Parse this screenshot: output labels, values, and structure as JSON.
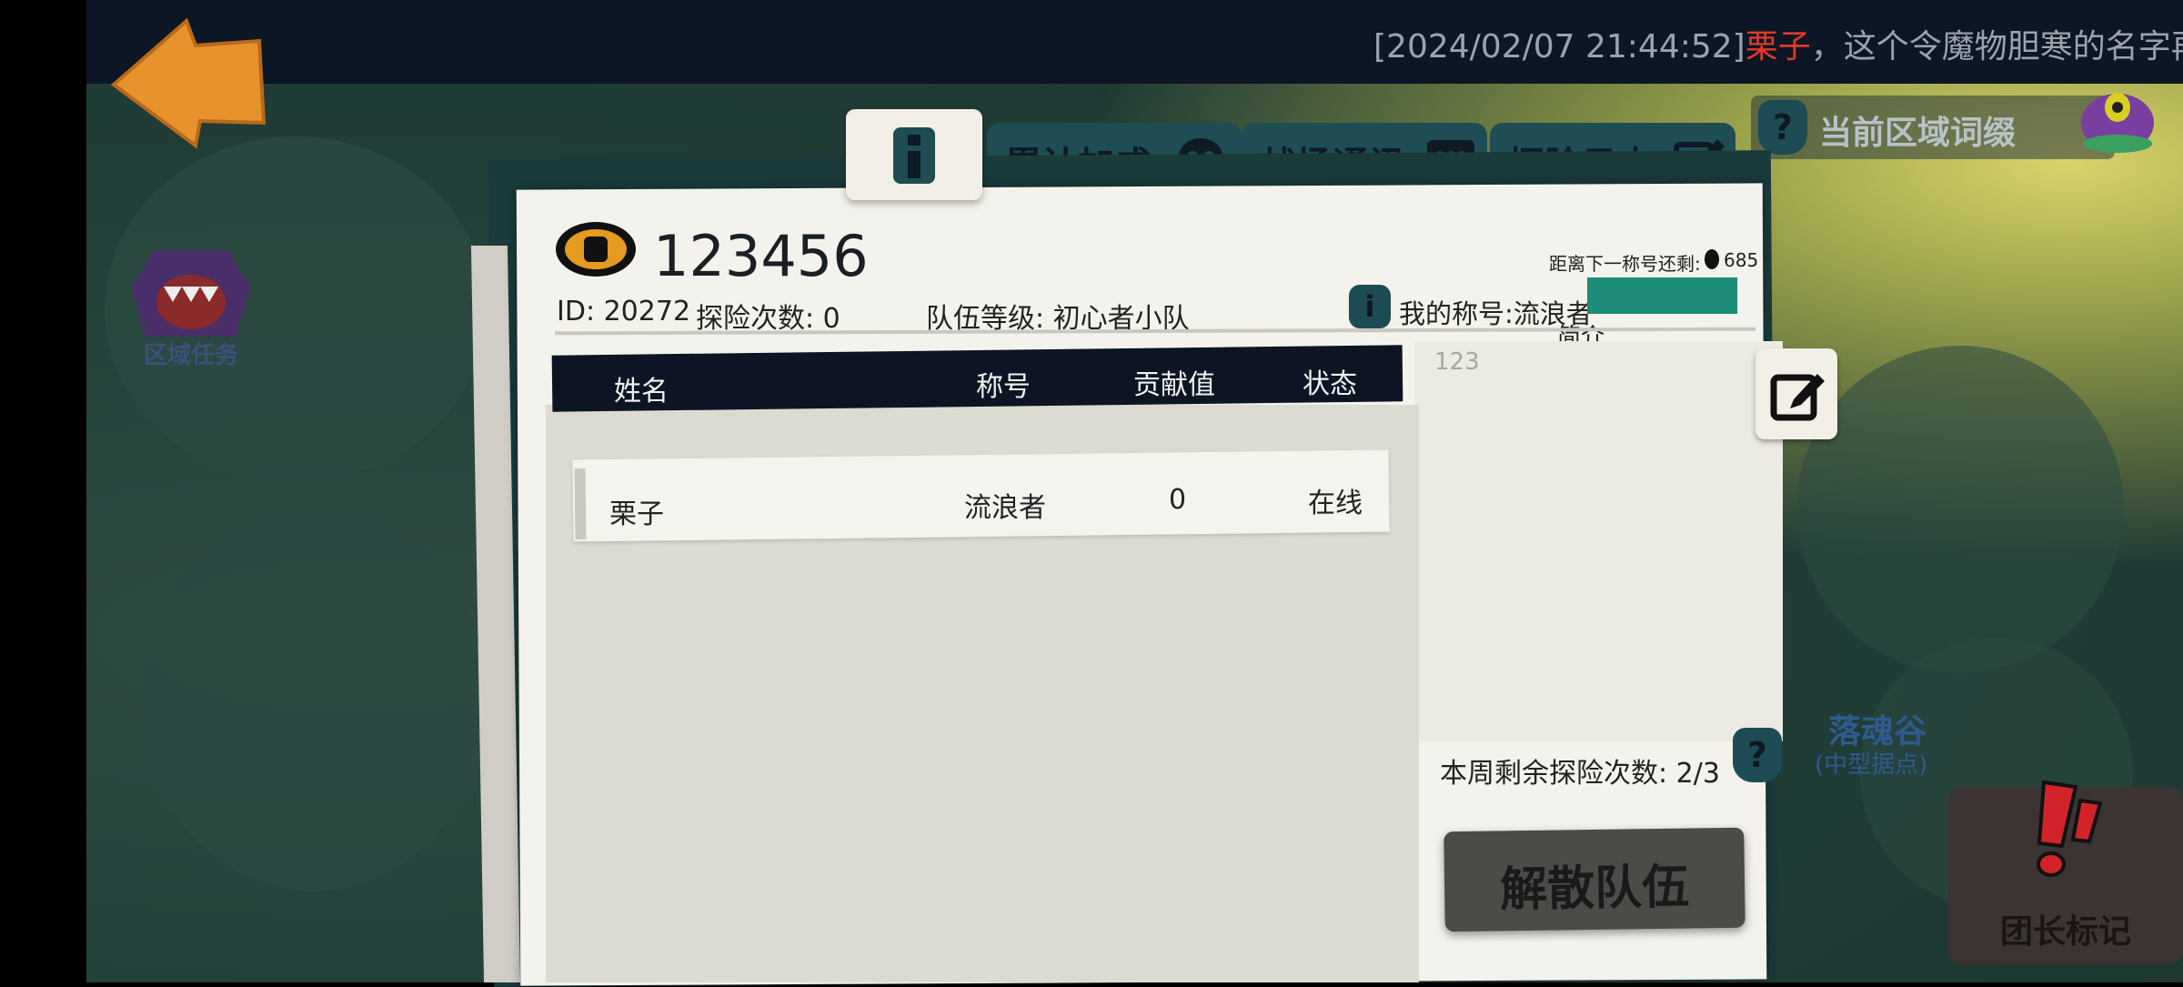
{
  "ticker": {
    "timestamp": "[2024/02/07 21:44:52]",
    "player_name": "栗子",
    "message": "，这个令魔物胆寒的名字再次"
  },
  "left_menu": {
    "area_task_label": "区域任务"
  },
  "top_right": {
    "region_affix_label": "当前区域词缀"
  },
  "tabs": {
    "cumulative_bonus": "累计加成",
    "battlefield_comms": "战场通讯",
    "adventure_log": "探险日志"
  },
  "team": {
    "name": "123456",
    "id_text": "ID: 20272",
    "adventure_count": "探险次数: 0",
    "team_level": "队伍等级: 初心者小队",
    "next_title_label": "距离下一称号还剩:",
    "next_title_value": "685",
    "my_title": "我的称号:流浪者",
    "intro_label": "简介",
    "intro_text": "123"
  },
  "table": {
    "headers": [
      "姓名",
      "称号",
      "贡献值",
      "状态"
    ],
    "rows": [
      {
        "name": "栗子",
        "title": "流浪者",
        "contribution": "0",
        "status": "在线"
      }
    ]
  },
  "weekly_remaining": "本周剩余探险次数:  2/3",
  "disband_button": "解散队伍",
  "location": {
    "name": "落魂谷",
    "subtitle": "(中型据点)"
  },
  "leader_mark_label": "团长标记",
  "colors": {
    "accent_teal": "#1e4d54",
    "header_dark": "#0d1424",
    "player_name_red": "#e23a2a",
    "title_bar_green": "#1c8b78",
    "back_arrow_orange": "#e8922e"
  }
}
